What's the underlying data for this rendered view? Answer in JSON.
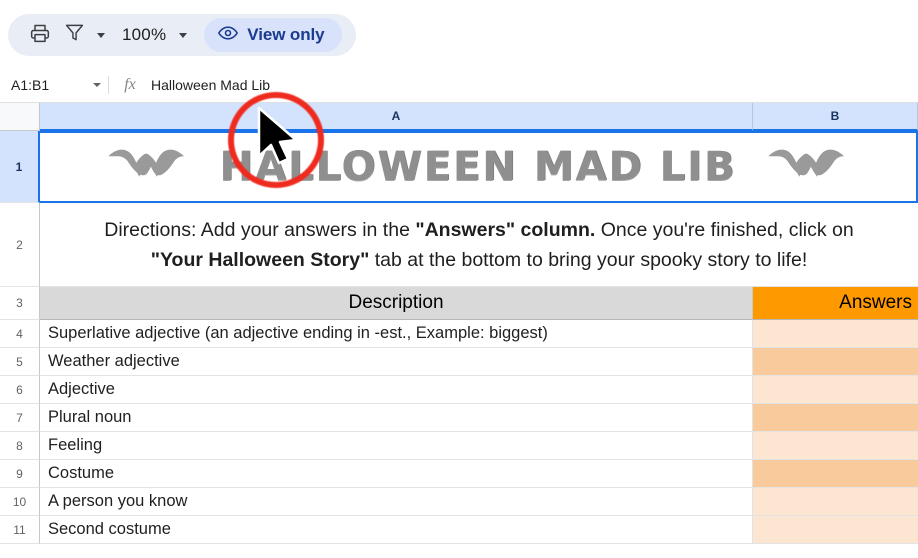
{
  "toolbar": {
    "print_icon": "print-icon",
    "filter_icon": "filter-icon",
    "filter_caret": "chevron-down-icon",
    "zoom_level": "100%",
    "zoom_caret": "chevron-down-icon",
    "view_only_icon": "eye-icon",
    "view_only_label": "View only",
    "pill_bg": "#e8edf6",
    "view_only_bg": "#d8e2fb",
    "view_only_text_color": "#1a3b8f"
  },
  "formula_bar": {
    "name_box": "A1:B1",
    "name_box_caret": "chevron-down-icon",
    "fx_icon": "fx-icon",
    "formula_value": "Halloween Mad Lib"
  },
  "grid": {
    "columns": [
      {
        "label": "A",
        "selected": true
      },
      {
        "label": "B",
        "selected": true
      }
    ],
    "selection_color": "#1a73e8",
    "header_selected_bg": "#d3e3fd",
    "title_row": {
      "row_number": "1",
      "selected": true,
      "title": "HALLOWEEN MAD LIB",
      "left_bat": "bat-icon",
      "right_bat": "bat-icon",
      "bat_color": "#9a9a9a",
      "title_color": "#8f8f8f"
    },
    "directions_row": {
      "row_number": "2",
      "line1_part1": "Directions: Add your answers in the ",
      "line1_bold": "\"Answers\" column.",
      "line1_part2": " Once you're finished, click on",
      "line2_bold": "\"Your Halloween Story\"",
      "line2_rest": " tab at the bottom to bring your spooky story to life!"
    },
    "header_row": {
      "row_number": "3",
      "description_header": "Description",
      "answers_header": "Answers",
      "description_bg": "#d9d9d9",
      "answers_bg": "#ff9900"
    },
    "answer_band_light": "#fce5d1",
    "answer_band_dark": "#f9cb9c",
    "data_rows": [
      {
        "row_number": "4",
        "description": "Superlative adjective (an adjective ending in -est., Example: biggest)",
        "answer": "",
        "band": "light"
      },
      {
        "row_number": "5",
        "description": "Weather adjective",
        "answer": "",
        "band": "dark"
      },
      {
        "row_number": "6",
        "description": "Adjective",
        "answer": "",
        "band": "light"
      },
      {
        "row_number": "7",
        "description": "Plural noun",
        "answer": "",
        "band": "dark"
      },
      {
        "row_number": "8",
        "description": "Feeling",
        "answer": "",
        "band": "light"
      },
      {
        "row_number": "9",
        "description": "Costume",
        "answer": "",
        "band": "dark"
      },
      {
        "row_number": "10",
        "description": "A person you know",
        "answer": "",
        "band": "light"
      },
      {
        "row_number": "11",
        "description": "Second costume",
        "answer": "",
        "band": "light"
      }
    ]
  },
  "annotations": {
    "highlight_circle": "red-highlight-circle",
    "highlight_color": "#ef2b1f",
    "cursor": "mouse-cursor"
  }
}
